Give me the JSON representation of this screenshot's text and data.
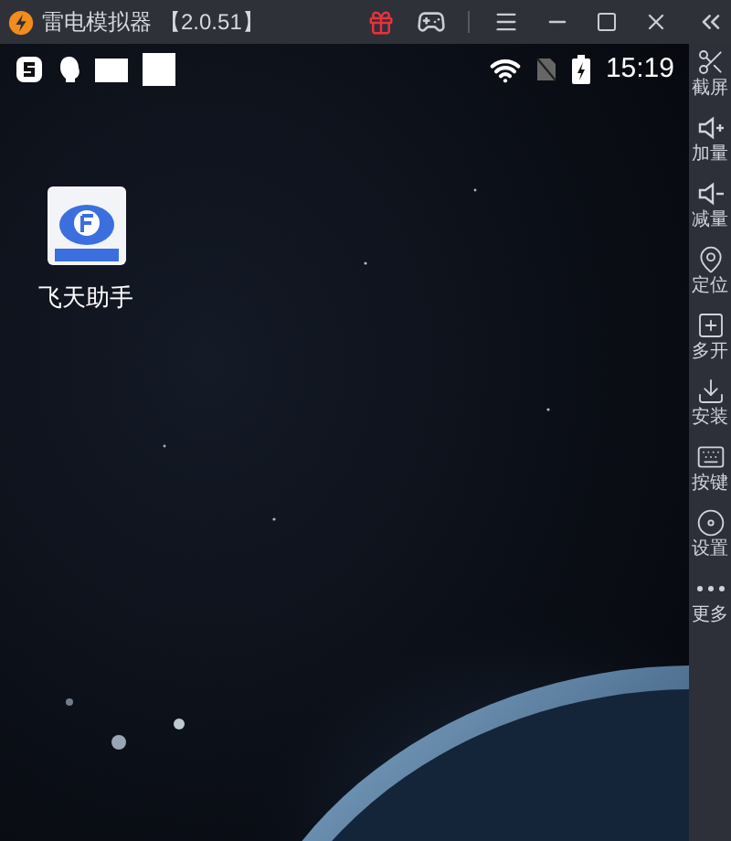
{
  "window": {
    "title": "雷电模拟器",
    "version": "【2.0.51】"
  },
  "status_bar": {
    "time": "15:19"
  },
  "desktop": {
    "apps": [
      {
        "label": "飞天助手"
      }
    ]
  },
  "sidebar": {
    "items": [
      {
        "kind": "screenshot",
        "label": "截屏"
      },
      {
        "kind": "volume_up",
        "label": "加量"
      },
      {
        "kind": "volume_down",
        "label": "减量"
      },
      {
        "kind": "location",
        "label": "定位"
      },
      {
        "kind": "multi",
        "label": "多开"
      },
      {
        "kind": "install",
        "label": "安装"
      },
      {
        "kind": "keys",
        "label": "按键"
      },
      {
        "kind": "settings",
        "label": "设置"
      },
      {
        "kind": "more",
        "label": "更多"
      }
    ]
  }
}
